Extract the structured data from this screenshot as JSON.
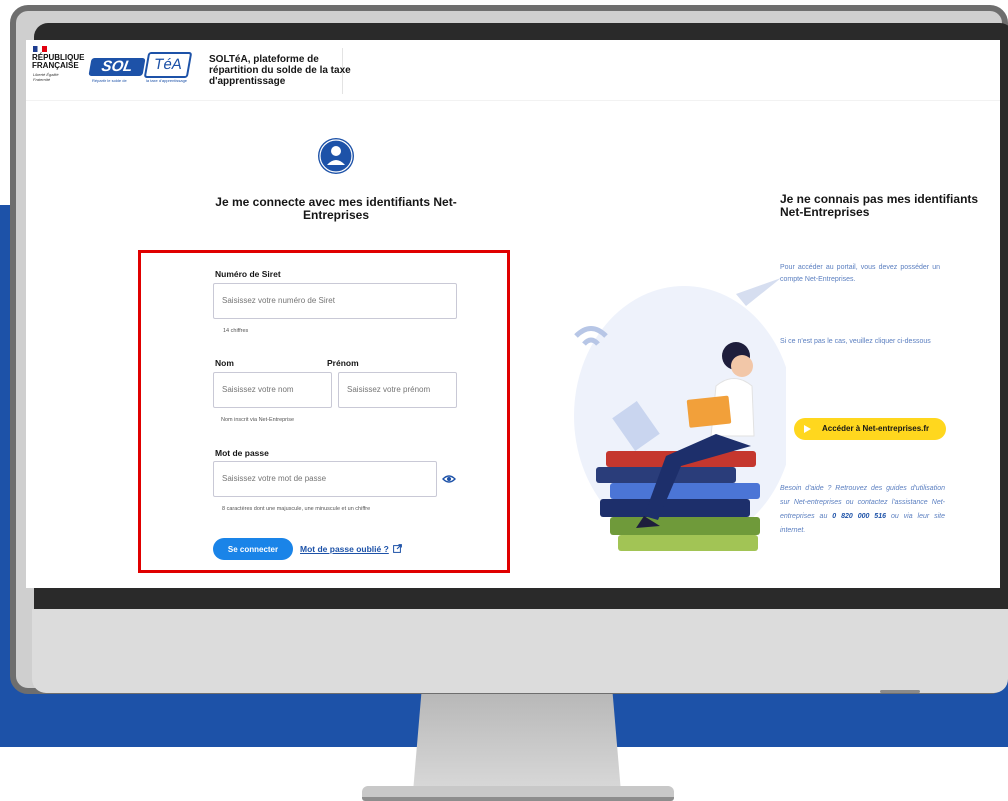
{
  "header": {
    "gov_name": "RÉPUBLIQUE FRANÇAISE",
    "gov_motto": "Liberté Égalité Fraternité",
    "logo_sol": "SOL",
    "logo_tea": "TéA",
    "logo_tag_left": "Répartir le solde de",
    "logo_tag_right": "la taxe d'apprentissage",
    "title": "SOLTéA, plateforme de répartition du solde de la taxe d'apprentissage"
  },
  "login": {
    "title": "Je me connecte avec mes identifiants Net-Entreprises",
    "siret_label": "Numéro de Siret",
    "siret_placeholder": "Saisissez votre numéro de Siret",
    "siret_hint": "14 chiffres",
    "nom_label": "Nom",
    "nom_placeholder": "Saisissez votre nom",
    "prenom_label": "Prénom",
    "prenom_placeholder": "Saisissez votre prénom",
    "nom_hint": "Nom inscrit via Net-Entreprise",
    "password_label": "Mot de passe",
    "password_placeholder": "Saisissez votre mot de passe",
    "password_hint": "8 caractères dont une majuscule, une minuscule et un chiffre",
    "submit_label": "Se connecter",
    "forgot_label": "Mot de passe oublié ?"
  },
  "help": {
    "title": "Je ne connais pas mes identifiants Net-Entreprises",
    "p1": "Pour accéder au portail, vous devez posséder un compte Net-Entreprises.",
    "p2": "Si ce n'est pas le cas, veuillez cliquer ci-dessous",
    "button_label": "Accéder à Net-entreprises.fr",
    "footer_intro": "Besoin d'aide ? Retrouvez des guides d'utilisation sur Net-entreprises ou contactez l'assistance Net-entreprises au",
    "phone": "0 820 000 516",
    "footer_end": "ou via leur site internet."
  },
  "colors": {
    "brand_blue": "#1d52a8",
    "button_blue": "#1a84e8",
    "highlight_red": "#e00000",
    "cta_yellow": "#ffd71e"
  }
}
